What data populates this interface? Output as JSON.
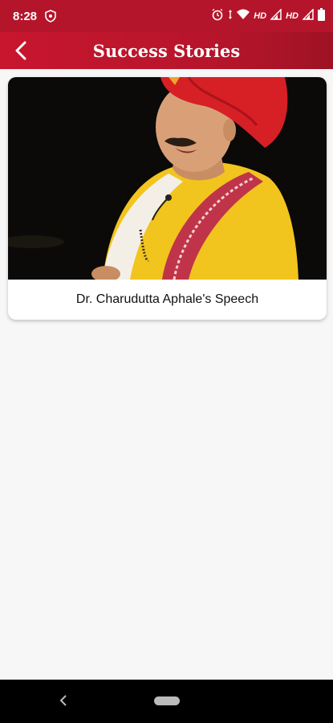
{
  "status_bar": {
    "time": "8:28",
    "hd_1": "HD",
    "hd_2": "HD"
  },
  "header": {
    "title": "Success Stories"
  },
  "stories": [
    {
      "title": "Dr. Charudutta Aphale's Speech"
    }
  ],
  "colors": {
    "primary": "#b5152a",
    "background": "#f7f7f7",
    "nav_bar": "#000000"
  }
}
